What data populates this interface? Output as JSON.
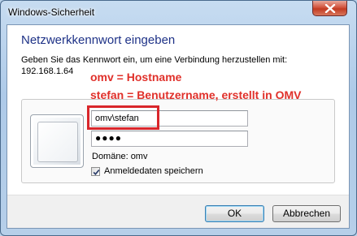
{
  "window": {
    "title": "Windows-Sicherheit"
  },
  "dialog": {
    "heading": "Netzwerkkennwort eingeben",
    "description": "Geben Sie das Kennwort ein, um eine Verbindung herzustellen mit:",
    "target": "192.168.1.64"
  },
  "annotations": {
    "line1": "omv = Hostname",
    "line2": "stefan = Benutzername, erstellt in OMV"
  },
  "credentials": {
    "username_value": "omv\\stefan",
    "password_mask": "●●●●",
    "domain_text": "Domäne: omv",
    "remember_label": "Anmeldedaten speichern",
    "remember_checked": true
  },
  "buttons": {
    "ok": "OK",
    "cancel": "Abbrechen"
  },
  "colors": {
    "annotation": "#e0302a",
    "heading": "#1e3287",
    "highlight": "#d9262b"
  }
}
